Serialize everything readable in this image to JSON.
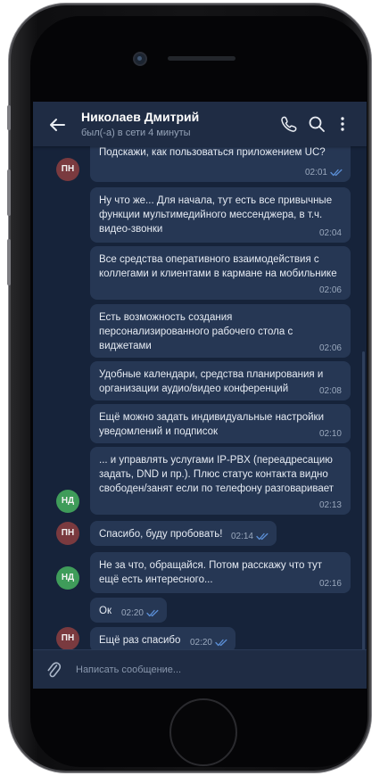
{
  "header": {
    "contact_name": "Николаев Дмитрий",
    "contact_status": "был(-а) в сети 4 минуты",
    "icons": [
      "back-arrow-icon",
      "phone-icon",
      "search-icon",
      "more-vert-icon"
    ]
  },
  "messages": [
    {
      "sender": "ПН",
      "text": "Подскажи, как пользоваться приложением UC?",
      "time": "02:01",
      "read": true
    },
    {
      "sender": "НД",
      "text": "Ну что же... Для начала, тут есть все привычные функции мультимедийного мессенджера, в т.ч. видео-звонки",
      "time": "02:04"
    },
    {
      "sender": "НД",
      "text": "Все средства оперативного взаимодействия с коллегами и клиентами в кармане на мобильнике",
      "time": "02:06"
    },
    {
      "sender": "НД",
      "text": "Есть возможность создания персонализированного рабочего стола с виджетами",
      "time": "02:06"
    },
    {
      "sender": "НД",
      "text": "Удобные календари, средства планирования и организации аудио/видео конференций",
      "time": "02:08"
    },
    {
      "sender": "НД",
      "text": "Ещё можно задать индивидуальные настройки уведомлений и подписок",
      "time": "02:10"
    },
    {
      "sender": "НД",
      "text": "... и управлять услугами IP-PBX (переадресацию задать, DND и пр.). Плюс статус контакта видно свободен/занят если по телефону разговаривает",
      "time": "02:13"
    },
    {
      "sender": "ПН",
      "text": "Спасибо, буду пробовать!",
      "time": "02:14",
      "read": true
    },
    {
      "sender": "НД",
      "text": "Не за что, обращайся. Потом расскажу что тут ещё есть интересного...",
      "time": "02:16"
    },
    {
      "sender": "ПН",
      "text": "Ок",
      "time": "02:20",
      "read": true
    },
    {
      "sender": "ПН",
      "text": "Ещё раз спасибо",
      "time": "02:20",
      "read": true
    }
  ],
  "composer": {
    "placeholder": "Написать сообщение...",
    "attach_icon": "paperclip-icon"
  },
  "colors": {
    "screen_bg": "#16233a",
    "header_bg": "#1f2c44",
    "bubble_bg": "#263754",
    "avatar_pn": "#7a3a3f",
    "avatar_nd": "#3f9c5a",
    "read_check": "#5b8fd6"
  }
}
